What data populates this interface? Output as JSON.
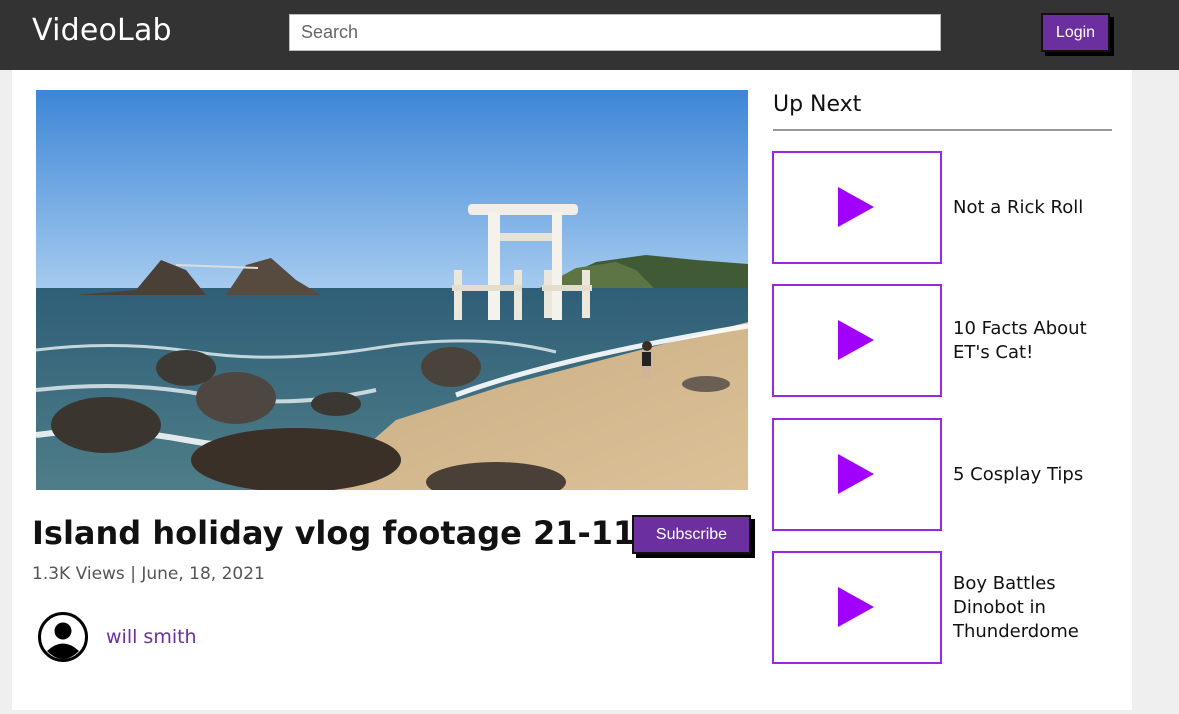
{
  "header": {
    "brand": "VideoLab",
    "search_placeholder": "Search",
    "login_label": "Login"
  },
  "video": {
    "title": "Island holiday vlog footage 21-11-5",
    "meta": "1.3K Views | June, 18, 2021",
    "subscribe_label": "Subscribe",
    "channel_name": "will smith"
  },
  "up_next": {
    "heading": "Up Next",
    "items": [
      {
        "title": "Not a Rick Roll"
      },
      {
        "title": "10 Facts About ET's Cat!"
      },
      {
        "title": "5 Cosplay Tips"
      },
      {
        "title": "Boy Battles Dinobot in Thunderdome"
      }
    ]
  },
  "colors": {
    "header_bg": "#333333",
    "accent": "#6b2fa0",
    "thumb_border": "#9c27e0",
    "play_icon": "#a100ff"
  }
}
